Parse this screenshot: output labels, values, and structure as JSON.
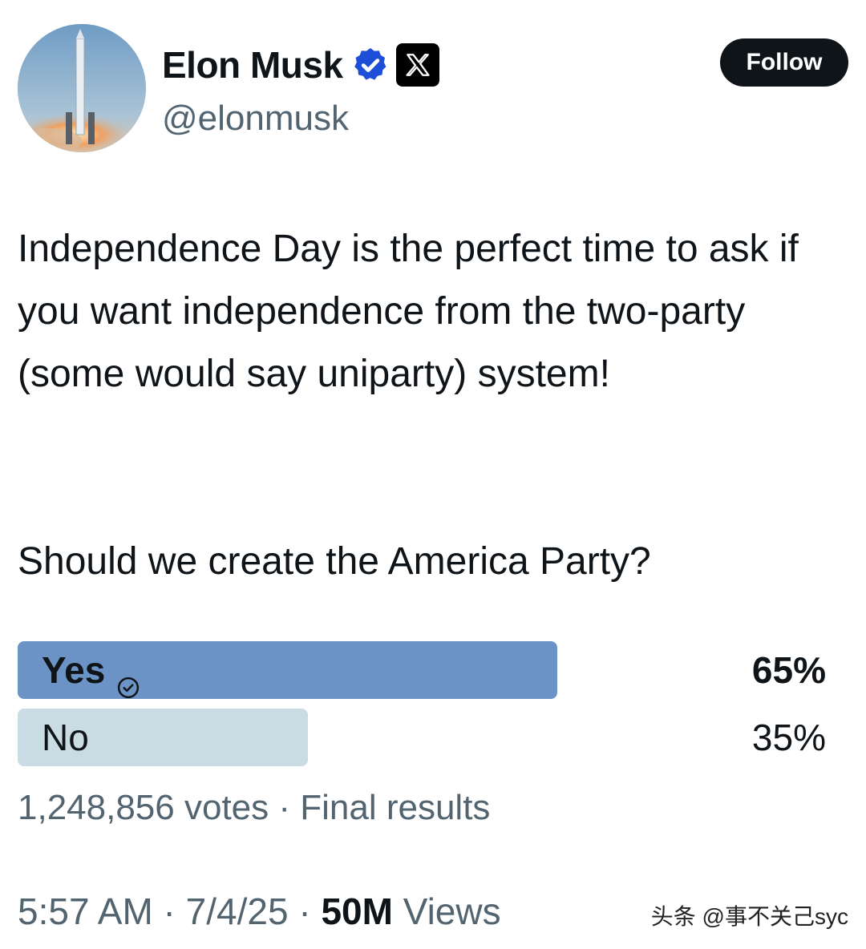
{
  "author": {
    "name": "Elon Musk",
    "handle": "@elonmusk",
    "follow_label": "Follow"
  },
  "tweet": {
    "text": "Independence Day is the perfect time to ask if you want independence from the two-party (some would say uniparty) system!",
    "question": "Should we create the America Party?"
  },
  "poll": {
    "options": [
      {
        "label": "Yes",
        "percent_label": "65%",
        "fraction": 0.65,
        "winner": true
      },
      {
        "label": "No",
        "percent_label": "35%",
        "fraction": 0.35,
        "winner": false
      }
    ],
    "meta": "1,248,856 votes · Final results"
  },
  "footer": {
    "time": "5:57 AM",
    "separator": " · ",
    "date": "7/4/25",
    "views_count": "50M",
    "views_label": " Views"
  },
  "watermark": "头条 @事不关己syc",
  "colors": {
    "winner_bar": "#6b93c5",
    "loser_bar": "#c9dce4",
    "verified": "#1d4ed8"
  },
  "icons": {
    "verified": "verified-badge-icon",
    "x_logo": "x-logo-icon",
    "check": "check-circle-icon"
  }
}
